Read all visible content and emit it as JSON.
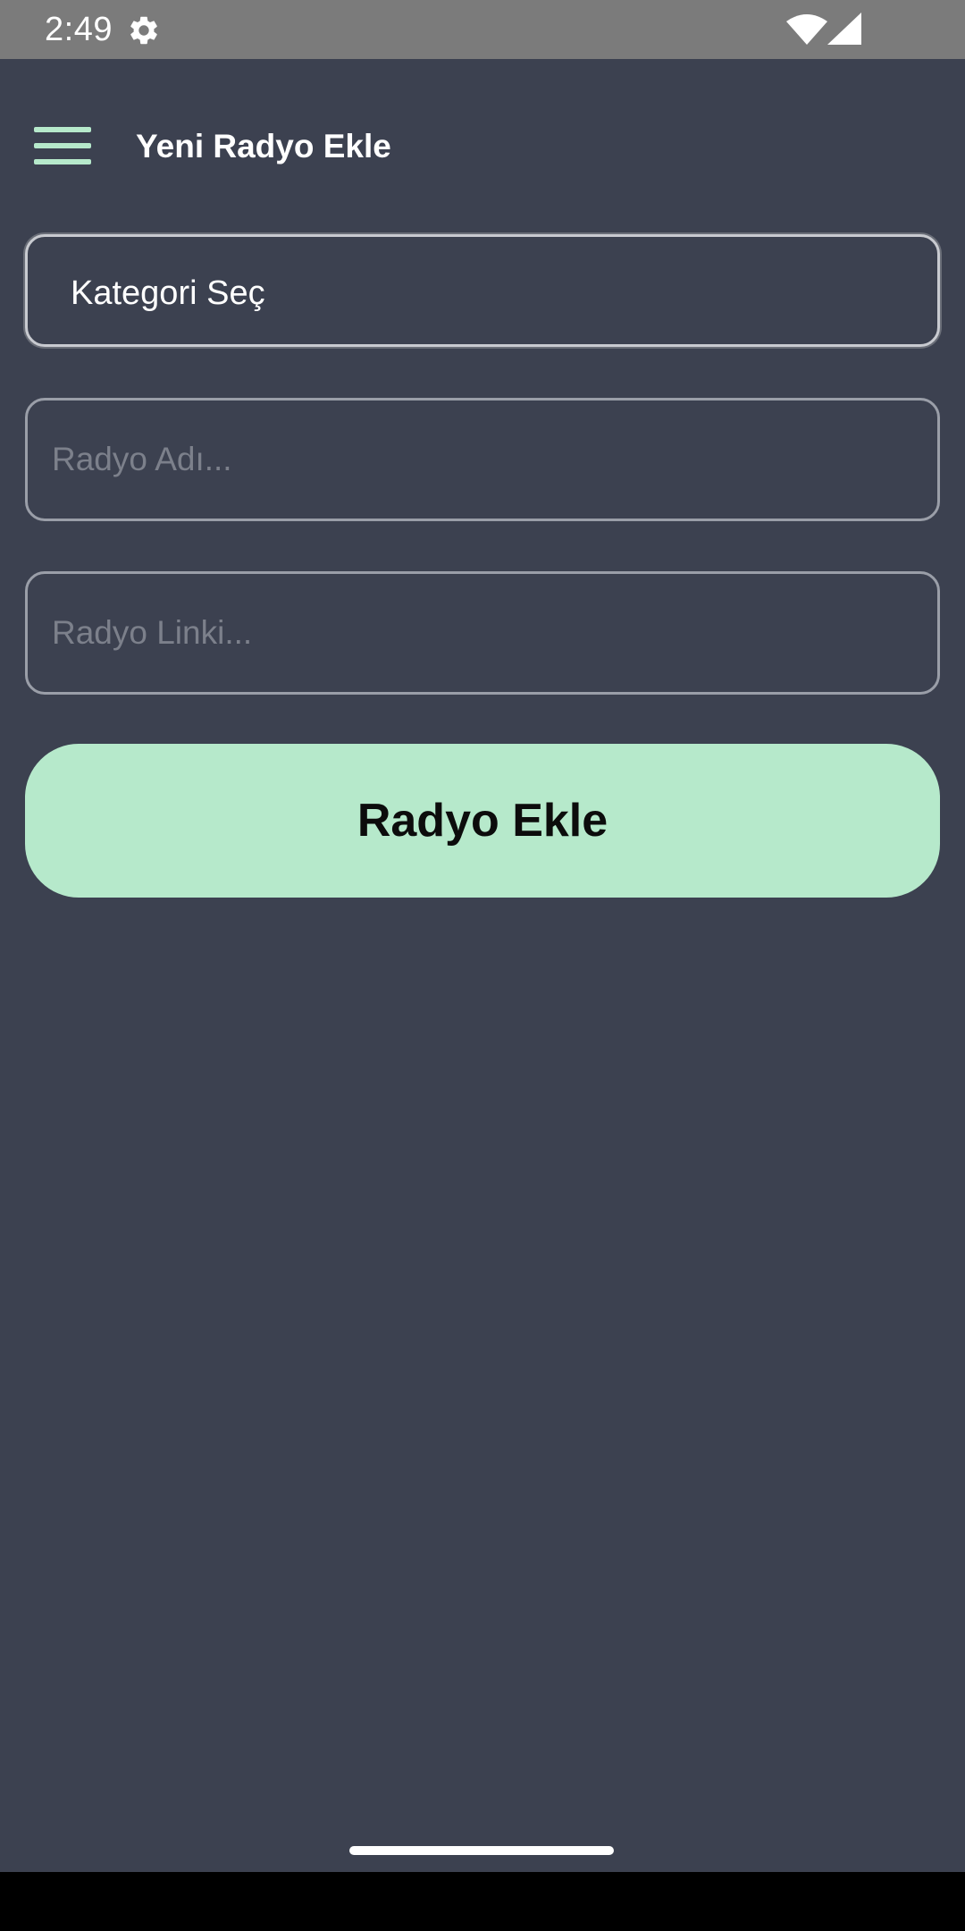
{
  "status_bar": {
    "time": "2:49",
    "icons": [
      "gear-icon",
      "wifi-icon",
      "cell-signal-icon"
    ]
  },
  "app_bar": {
    "title": "Yeni Radyo Ekle",
    "menu_icon": "hamburger-menu-icon"
  },
  "form": {
    "category_select": {
      "selected": "Kategori Seç"
    },
    "radio_name": {
      "value": "",
      "placeholder": "Radyo Adı..."
    },
    "radio_link": {
      "value": "",
      "placeholder": "Radyo Linki..."
    },
    "submit_label": "Radyo Ekle"
  },
  "colors": {
    "background": "#3c4150",
    "accent": "#b6e9cb",
    "status_bar": "#7b7b7b",
    "text_primary": "#ffffff",
    "placeholder": "#7c808b",
    "button_text": "#0c0c0c"
  }
}
